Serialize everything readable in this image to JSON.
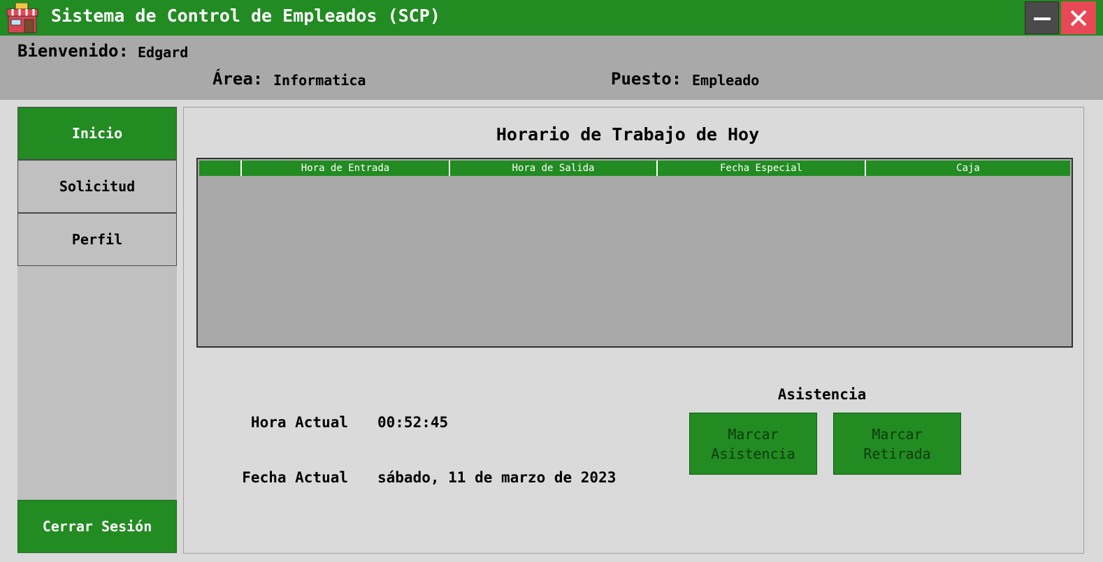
{
  "window": {
    "title": "Sistema de Control de Empleados (SCP)"
  },
  "header": {
    "welcome_label": "Bienvenido:",
    "welcome_value": "Edgard",
    "area_label": "Área:",
    "area_value": "Informatica",
    "puesto_label": "Puesto:",
    "puesto_value": "Empleado"
  },
  "sidebar": {
    "items": [
      {
        "label": "Inicio",
        "active": true
      },
      {
        "label": "Solicitud",
        "active": false
      },
      {
        "label": "Perfil",
        "active": false
      }
    ],
    "logout_label": "Cerrar Sesión"
  },
  "main": {
    "title": "Horario de Trabajo de Hoy",
    "table": {
      "columns": [
        "",
        "Hora de Entrada",
        "Hora de Salida",
        "Fecha Especial",
        "Caja"
      ],
      "rows": []
    },
    "hora_label": "Hora Actual",
    "hora_value": "00:52:45",
    "fecha_label": "Fecha Actual",
    "fecha_value": "sábado, 11 de marzo de 2023",
    "asistencia": {
      "title": "Asistencia",
      "marcar_asistencia": "Marcar\nAsistencia",
      "marcar_retirada": "Marcar\nRetirada"
    }
  },
  "colors": {
    "accent_green": "#228b22",
    "header_gray": "#a9a9a9",
    "close_red": "#e84856"
  }
}
